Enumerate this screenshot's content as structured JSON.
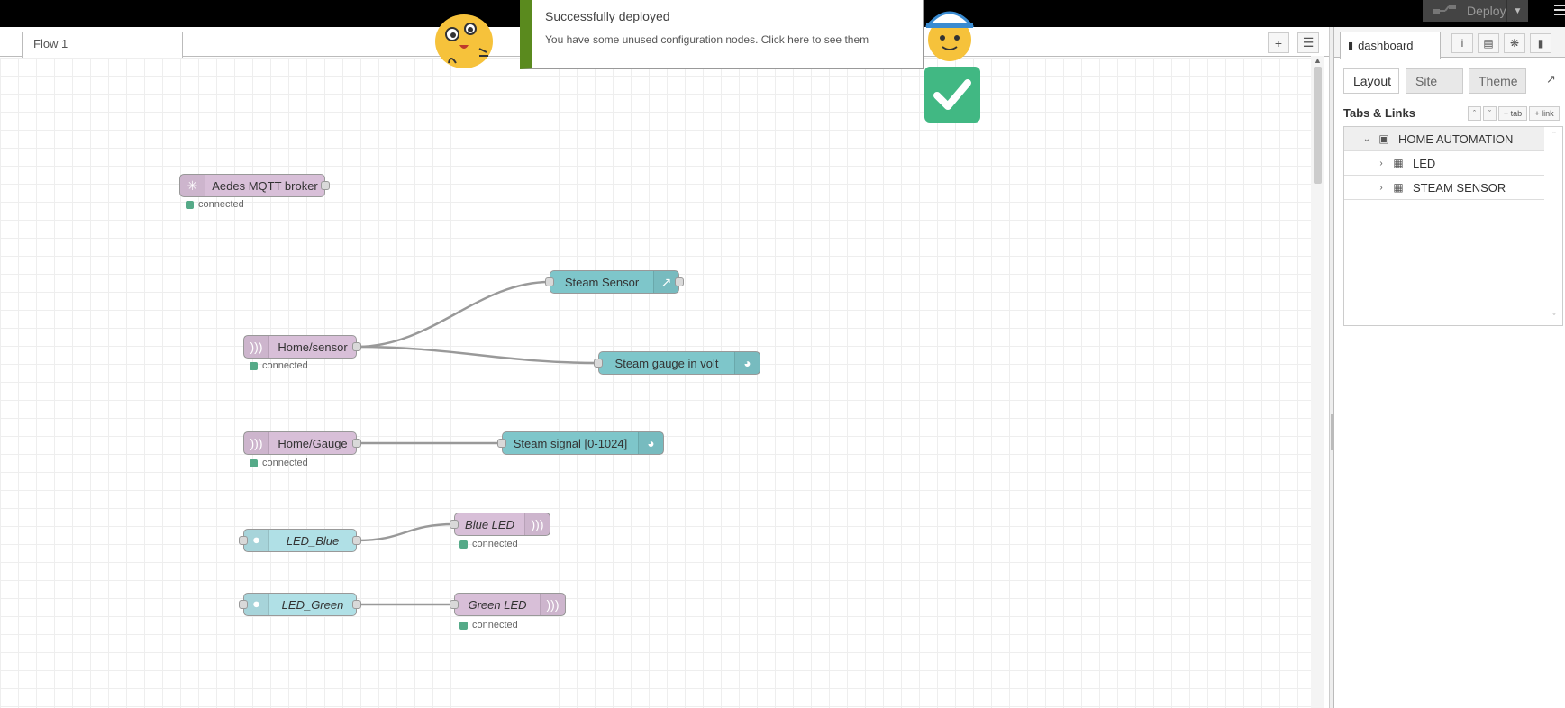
{
  "header": {
    "deploy_label": "Deploy"
  },
  "workspace": {
    "flow_tab_label": "Flow 1"
  },
  "notification": {
    "title": "Successfully deployed",
    "message": "You have some unused configuration nodes. Click here to see them"
  },
  "nodes": {
    "aedes": {
      "label": "Aedes MQTT broker",
      "status": "connected"
    },
    "steam_sensor": {
      "label": "Steam Sensor"
    },
    "home_sensor": {
      "label": "Home/sensor",
      "status": "connected"
    },
    "steam_gauge_volt": {
      "label": "Steam gauge in volt"
    },
    "home_gauge": {
      "label": "Home/Gauge",
      "status": "connected"
    },
    "steam_signal": {
      "label": "Steam signal [0-1024]"
    },
    "led_blue": {
      "label": "LED_Blue"
    },
    "blue_led": {
      "label": "Blue LED",
      "status": "connected"
    },
    "led_green": {
      "label": "LED_Green"
    },
    "green_led": {
      "label": "Green LED",
      "status": "connected"
    }
  },
  "sidebar": {
    "tab_label": "dashboard",
    "subtabs": [
      "Layout",
      "Site",
      "Theme"
    ],
    "tabs_links_title": "Tabs & Links",
    "btn_tab": "+ tab",
    "btn_link": "+ link",
    "tree": [
      {
        "label": "HOME AUTOMATION"
      },
      {
        "label": "LED"
      },
      {
        "label": "STEAM SENSOR"
      }
    ]
  },
  "colors": {
    "mqtt_node": "#d8bfd8",
    "dashboard_node": "#7ec6ca",
    "switch_node": "#b0e0e6",
    "status_connected": "#55aa88",
    "notification_accent": "#5a8a1e"
  }
}
